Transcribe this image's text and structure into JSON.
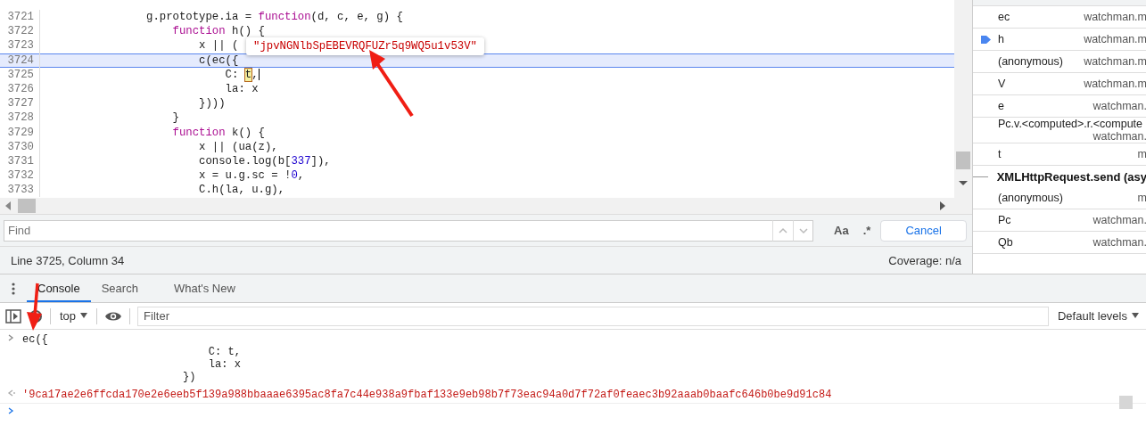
{
  "editor": {
    "lines": [
      {
        "number": "3721",
        "highlighted": false,
        "tokens": [
          {
            "kind": "plain",
            "text": "                g.prototype.ia = "
          },
          {
            "kind": "keyword",
            "text": "function"
          },
          {
            "kind": "plain",
            "text": "(d, c, e, g) {"
          }
        ]
      },
      {
        "number": "3722",
        "highlighted": false,
        "tokens": [
          {
            "kind": "keyword",
            "text": "                    function"
          },
          {
            "kind": "plain",
            "text": " h() {"
          }
        ]
      },
      {
        "number": "3723",
        "highlighted": false,
        "tokens": [
          {
            "kind": "plain",
            "text": "                        x || ("
          }
        ]
      },
      {
        "number": "3724",
        "highlighted": true,
        "tokens": [
          {
            "kind": "plain",
            "text": "                        c(ec({"
          }
        ]
      },
      {
        "number": "3725",
        "highlighted": false,
        "tokens": [
          {
            "kind": "plain",
            "text": "                            C: "
          },
          {
            "kind": "match",
            "text": "t"
          },
          {
            "kind": "plain",
            "text": ","
          }
        ]
      },
      {
        "number": "3726",
        "highlighted": false,
        "tokens": [
          {
            "kind": "plain",
            "text": "                            la: x"
          }
        ]
      },
      {
        "number": "3727",
        "highlighted": false,
        "tokens": [
          {
            "kind": "plain",
            "text": "                        })))"
          }
        ]
      },
      {
        "number": "3728",
        "highlighted": false,
        "tokens": [
          {
            "kind": "plain",
            "text": "                    }"
          }
        ]
      },
      {
        "number": "3729",
        "highlighted": false,
        "tokens": [
          {
            "kind": "keyword",
            "text": "                    function"
          },
          {
            "kind": "plain",
            "text": " k() {"
          }
        ]
      },
      {
        "number": "3730",
        "highlighted": false,
        "tokens": [
          {
            "kind": "plain",
            "text": "                        x || (ua(z),"
          }
        ]
      },
      {
        "number": "3731",
        "highlighted": false,
        "tokens": [
          {
            "kind": "plain",
            "text": "                        console.log(b["
          },
          {
            "kind": "number",
            "text": "337"
          },
          {
            "kind": "plain",
            "text": "]),"
          }
        ]
      },
      {
        "number": "3732",
        "highlighted": false,
        "tokens": [
          {
            "kind": "plain",
            "text": "                        x = u.g.sc = !"
          },
          {
            "kind": "number",
            "text": "0"
          },
          {
            "kind": "plain",
            "text": ","
          }
        ]
      },
      {
        "number": "3733",
        "highlighted": false,
        "tokens": [
          {
            "kind": "plain",
            "text": "                        C.h(la, u.g),"
          }
        ]
      }
    ],
    "tooltip": "\"jpvNGNlbSpEBEVRQFUZr5q9WQ5u1v53V\""
  },
  "find_bar": {
    "placeholder": "Find",
    "match_case": "Aa",
    "regex": ".*",
    "cancel": "Cancel"
  },
  "status_bar": {
    "position": "Line 3725, Column 34",
    "coverage": "Coverage: n/a"
  },
  "call_stack": [
    {
      "kind": "frame",
      "name": "ec",
      "source": "watchman.m",
      "current": false
    },
    {
      "kind": "frame",
      "name": "h",
      "source": "watchman.m",
      "current": true
    },
    {
      "kind": "frame",
      "name": "(anonymous)",
      "source": "watchman.m",
      "current": false
    },
    {
      "kind": "frame",
      "name": "V",
      "source": "watchman.m",
      "current": false
    },
    {
      "kind": "frame",
      "name": "e",
      "source": "watchman.",
      "current": false
    },
    {
      "kind": "frame",
      "name": "Pc.v.<computed>.r.<compute",
      "source": "watchman.",
      "current": false
    },
    {
      "kind": "frame",
      "name": "t",
      "source": "m",
      "current": false
    },
    {
      "kind": "async",
      "name": "XMLHttpRequest.send (asy"
    },
    {
      "kind": "frame",
      "name": "(anonymous)",
      "source": "m",
      "current": false
    },
    {
      "kind": "frame",
      "name": "Pc",
      "source": "watchman.",
      "current": false
    },
    {
      "kind": "frame",
      "name": "Qb",
      "source": "watchman.",
      "current": false
    }
  ],
  "drawer_tabs": [
    {
      "label": "Console",
      "selected": true
    },
    {
      "label": "Search",
      "selected": false
    },
    {
      "label": "What's New",
      "selected": false
    }
  ],
  "console_toolbar": {
    "context": "top",
    "filter_placeholder": "Filter",
    "levels": "Default levels"
  },
  "console": {
    "entries": [
      {
        "kind": "input",
        "lines": [
          "ec({",
          "                             C: t,",
          "                             la: x",
          "                         })"
        ]
      },
      {
        "kind": "result",
        "lines": [
          "'9ca17ae2e6ffcda170e2e6eeb5f139a988bbaaae6395ac8fa7c44e938a9fbaf133e9eb98b7f73eac94a0d7f72af0feaec3b92aaab0baafc646b0be9d91c84"
        ]
      }
    ]
  }
}
